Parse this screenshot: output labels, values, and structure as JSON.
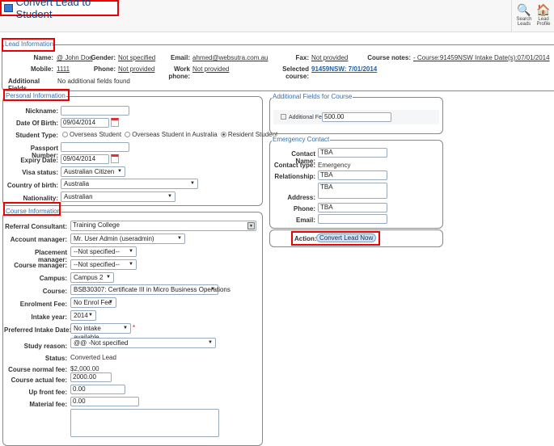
{
  "header": {
    "title": "Convert Lead to Student",
    "tools": [
      {
        "label1": "Search",
        "label2": "Leads",
        "icon": "magnifier-icon"
      },
      {
        "label1": "Lead",
        "label2": "Profile",
        "icon": "house-icon"
      }
    ]
  },
  "lead": {
    "legend": "Lead Information",
    "name_l": "Name:",
    "name": "@ John Doe",
    "gender_l": "Gender:",
    "gender": "Not specified",
    "email_l": "Email:",
    "email": "ahmed@websutra.com.au",
    "fax_l": "Fax:",
    "fax": "Not provided",
    "notes_l": "Course notes:",
    "notes": "- Course:91459NSW Intake Date(s):07/01/2014",
    "mobile_l": "Mobile:",
    "mobile": "1111",
    "phone_l": "Phone:",
    "phone": "Not provided",
    "work_l": "Work phone:",
    "work": "Not provided",
    "selcourse_l": "Selected course:",
    "selcourse": "91459NSW: 7/01/2014",
    "addf_l": "Additional Fields",
    "addf": "No additional fields found"
  },
  "personal": {
    "legend": "Personal Information",
    "nickname_l": "Nickname:",
    "nickname": "",
    "dob_l": "Date Of Birth:",
    "dob": "09/04/2014",
    "type_l": "Student Type:",
    "types": [
      "Overseas Student",
      "Overseas Student in Australia",
      "Resident Student"
    ],
    "type_selected": "Resident Student",
    "passport_l": "Passport Number:",
    "passport": "",
    "expiry_l": "Expiry Date:",
    "expiry": "09/04/2014",
    "visa_l": "Visa status:",
    "visa": "Australian Citizen",
    "country_l": "Country of birth:",
    "country": "Australia",
    "nat_l": "Nationality:",
    "nat": "Australian"
  },
  "course": {
    "legend": "Course Information",
    "referral_l": "Referral Consultant:",
    "referral": "Training College",
    "account_l": "Account manager:",
    "account": "Mr. User Admin (useradmin)",
    "placement_l": "Placement manager:",
    "placement": "--Not specified--",
    "cmanager_l": "Course manager:",
    "cmanager": "--Not specified--",
    "campus_l": "Campus:",
    "campus": "Campus 2",
    "course_l": "Course:",
    "course": "BSB30307: Certificate III in Micro Business Operations",
    "enrol_l": "Enrolment Fee:",
    "enrol": "No Enrol Fee",
    "year_l": "Intake year:",
    "year": "2014",
    "pref_l": "Preferred Intake Date:",
    "pref": "No intake available",
    "required": "*",
    "reason_l": "Study reason:",
    "reason": "@@ -Not specified",
    "status_l": "Status:",
    "status": "Converted Lead",
    "normal_l": "Course normal fee:",
    "normal": "$2,000.00",
    "actual_l": "Course actual fee:",
    "actual": "2000.00",
    "upfront_l": "Up front fee:",
    "upfront": "0.00",
    "material_l": "Material fee:",
    "material": "0.00"
  },
  "addfields": {
    "legend": "Additional Fields for Course",
    "fee_l": "Additional Fee",
    "fee": "500.00",
    "checked": false
  },
  "emergency": {
    "legend": "Emergency Contact",
    "name_l": "Contact Name:",
    "name": "TBA",
    "type_l": "Contact type:",
    "type": "Emergency",
    "rel_l": "Relationship:",
    "rel": "TBA",
    "addr_l": "Address:",
    "addr": "TBA",
    "phone_l": "Phone:",
    "phone": "TBA",
    "email_l": "Email:",
    "email": ""
  },
  "action": {
    "label": "Action:",
    "button": "Convert Lead Now"
  },
  "colors": {
    "highlight": "#e00000",
    "legend": "#3a6ea5",
    "link": "#1a5fa8"
  }
}
